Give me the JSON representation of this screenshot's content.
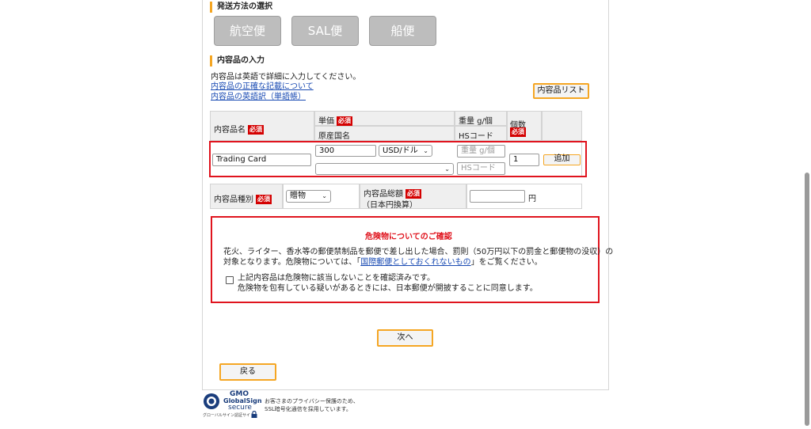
{
  "shipping": {
    "title": "発送方法の選択",
    "options": [
      "航空便",
      "SAL便",
      "船便"
    ]
  },
  "contents": {
    "title": "内容品の入力",
    "instruction": "内容品は英語で詳細に入力してください。",
    "link_accurate": "内容品の正確な記載について",
    "link_translation": "内容品の英語訳（単語帳）",
    "list_button": "内容品リスト"
  },
  "table": {
    "headers": {
      "name": "内容品名",
      "unit_price": "単価",
      "origin": "原産国名",
      "weight": "重量 g/個",
      "hs": "HSコード",
      "count": "個数"
    },
    "required_label": "必須",
    "row": {
      "name_value": "Trading Card",
      "price_value": "300",
      "currency": "USD/ドル",
      "origin_value": "",
      "weight_placeholder": "重量 g/個",
      "hs_placeholder": "HSコード",
      "count_value": "1",
      "add_button": "追加"
    }
  },
  "category": {
    "label": "内容品種別",
    "value": "贈物",
    "total_label": "内容品総額",
    "total_sub": "（日本円換算）",
    "total_value": "",
    "unit": "円"
  },
  "danger": {
    "title": "危険物についてのご確認",
    "line1": "花火、ライター、香水等の郵便禁制品を郵便で差し出した場合、罰則（50万円以下の罰金と郵便物の没収）の",
    "line2_pre": "対象となります。危険物については、「",
    "line2_link": "国際郵便としておくれないもの",
    "line2_post": "」をご覧ください。",
    "confirm1": "上記内容品は危険物に該当しないことを確認済みです。",
    "confirm2": "危険物を包有している疑いがあるときには、日本郵便が開披することに同意します。"
  },
  "nav": {
    "next": "次へ",
    "back": "戻る"
  },
  "footer": {
    "gmo": "GMO",
    "globalsign": "GlobalSign",
    "secure": "secure",
    "site_caption": "グローバルサイン認証サイト",
    "privacy1": "お客さまのプライバシー保護のため、",
    "privacy2": "SSL暗号化通信を採用しています。"
  },
  "colors": {
    "accent_orange": "#f5a623",
    "required_red": "#d40000",
    "warning_red": "#e0141e",
    "link_blue": "#1a4bb3"
  }
}
